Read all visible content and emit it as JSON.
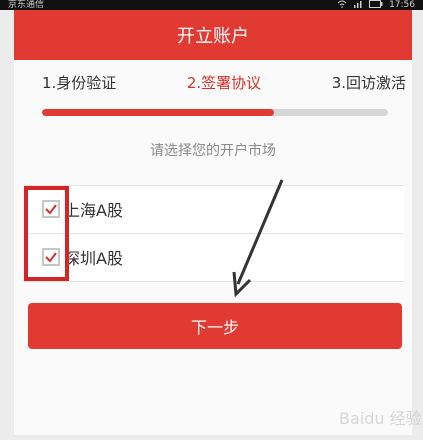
{
  "status_bar": {
    "carrier": "京东通信",
    "time": "17:56"
  },
  "header": {
    "title": "开立账户"
  },
  "steps": [
    {
      "label": "1.身份验证"
    },
    {
      "label": "2.签署协议"
    },
    {
      "label": "3.回访激活"
    }
  ],
  "progress": {
    "fraction": 0.67
  },
  "hint_text": "请选择您的开户市场",
  "markets": [
    {
      "label": "上海A股",
      "checked": true
    },
    {
      "label": "深圳A股",
      "checked": true
    }
  ],
  "actions": {
    "next_label": "下一步"
  },
  "watermark": {
    "text": "Baidu 经验"
  },
  "colors": {
    "primary_red": "#e03a32",
    "annotation_red": "#d32525"
  }
}
